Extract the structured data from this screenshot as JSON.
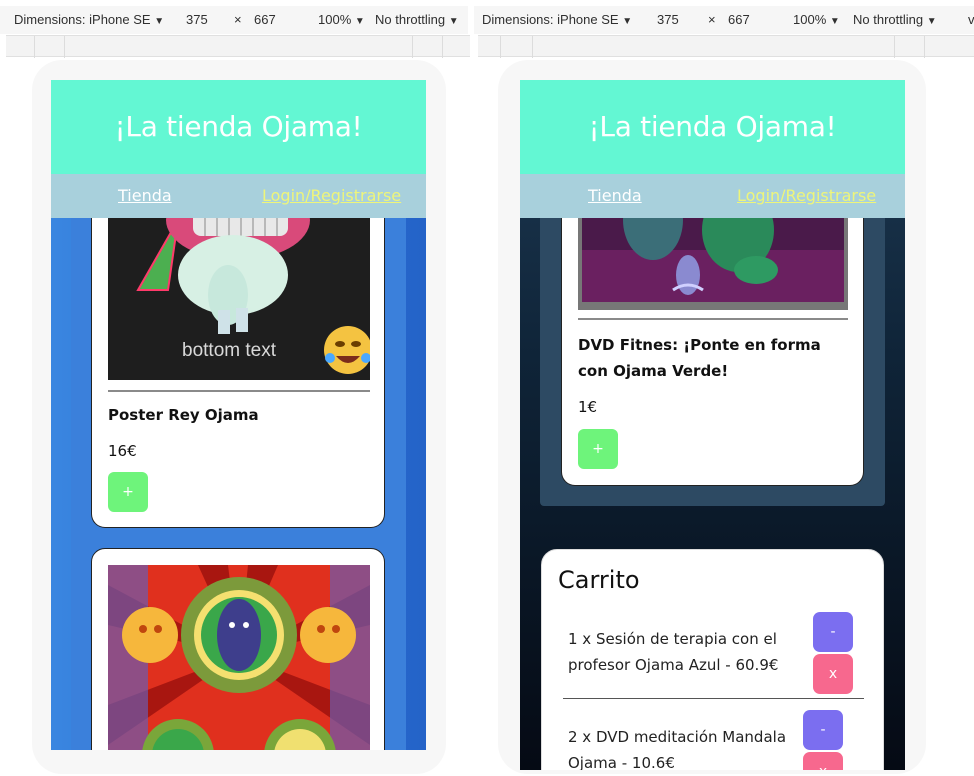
{
  "devtools": {
    "dimensions_label": "Dimensions: iPhone SE",
    "width": "375",
    "times": "×",
    "height": "667",
    "zoom": "100%",
    "throttle": "No throttling",
    "dropdown": "▼",
    "extra": "v"
  },
  "app": {
    "title": "¡La tienda Ojama!",
    "nav": {
      "shop": "Tienda",
      "login": "Login/Registrarse"
    }
  },
  "left": {
    "meme_text": "bottom text",
    "product1": {
      "name": "Poster Rey Ojama",
      "price": "16€",
      "add": "+"
    }
  },
  "right": {
    "product": {
      "name": "DVD Fitnes: ¡Ponte en forma con Ojama Verde!",
      "price": "1€",
      "add": "+"
    },
    "cart": {
      "title": "Carrito",
      "items": [
        {
          "text": "1 x Sesión de terapia con el profesor Ojama Azul - 60.9€",
          "minus": "-",
          "remove": "x"
        },
        {
          "text": "2 x DVD meditación Mandala Ojama - 10.6€",
          "minus": "-",
          "remove": "x"
        }
      ]
    }
  },
  "colors": {
    "header": "#63f7d3",
    "nav": "#a8d0dc",
    "link_login": "#eef57a",
    "plus": "#6ef47b",
    "minus": "#7b6ef0",
    "remove": "#f7688e"
  }
}
